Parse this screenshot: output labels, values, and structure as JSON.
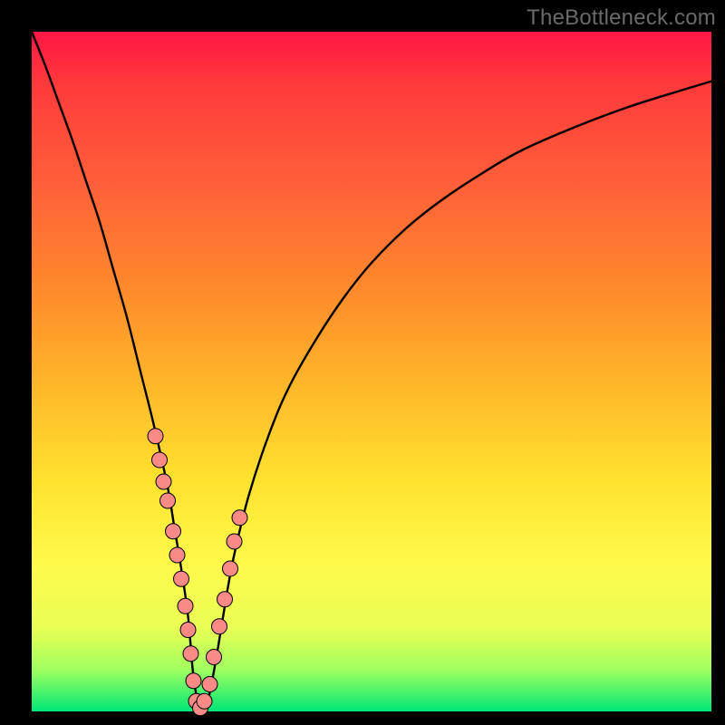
{
  "watermark": "TheBottleneck.com",
  "colors": {
    "frame": "#000000",
    "curve_stroke": "#000000",
    "marker_fill": "#fa8a86",
    "marker_stroke": "#000000"
  },
  "chart_data": {
    "type": "line",
    "title": "",
    "xlabel": "",
    "ylabel": "",
    "xlim": [
      0,
      100
    ],
    "ylim": [
      0,
      100
    ],
    "grid": false,
    "legend": false,
    "series": [
      {
        "name": "bottleneck-curve",
        "x": [
          0,
          2,
          4,
          6,
          8,
          10,
          12,
          14,
          16,
          18,
          20,
          21,
          22,
          23,
          23.7,
          24.3,
          25,
          26,
          27,
          28,
          29,
          30,
          32,
          35,
          38,
          42,
          46,
          50,
          55,
          60,
          66,
          72,
          80,
          88,
          96,
          100
        ],
        "y": [
          100,
          95,
          89.5,
          84,
          78,
          72,
          65,
          58,
          50,
          42,
          33,
          27,
          21,
          14,
          6,
          2,
          0,
          2,
          7,
          13,
          19,
          24,
          32,
          41,
          48,
          55,
          61,
          66,
          71,
          75,
          79,
          82.5,
          86,
          89,
          91.5,
          92.7
        ]
      }
    ],
    "markers": {
      "name": "highlight-points",
      "x": [
        18.2,
        18.8,
        19.4,
        20.0,
        20.8,
        21.4,
        22.0,
        22.6,
        23.0,
        23.4,
        23.8,
        24.2,
        24.8,
        25.4,
        26.2,
        26.8,
        27.6,
        28.4,
        29.2,
        29.8,
        30.6
      ],
      "y": [
        40.5,
        37.0,
        33.8,
        31.0,
        26.5,
        23.0,
        19.5,
        15.5,
        12.0,
        8.5,
        4.5,
        1.5,
        0.5,
        1.5,
        4.0,
        8.0,
        12.5,
        16.5,
        21.0,
        25.0,
        28.5
      ]
    }
  }
}
